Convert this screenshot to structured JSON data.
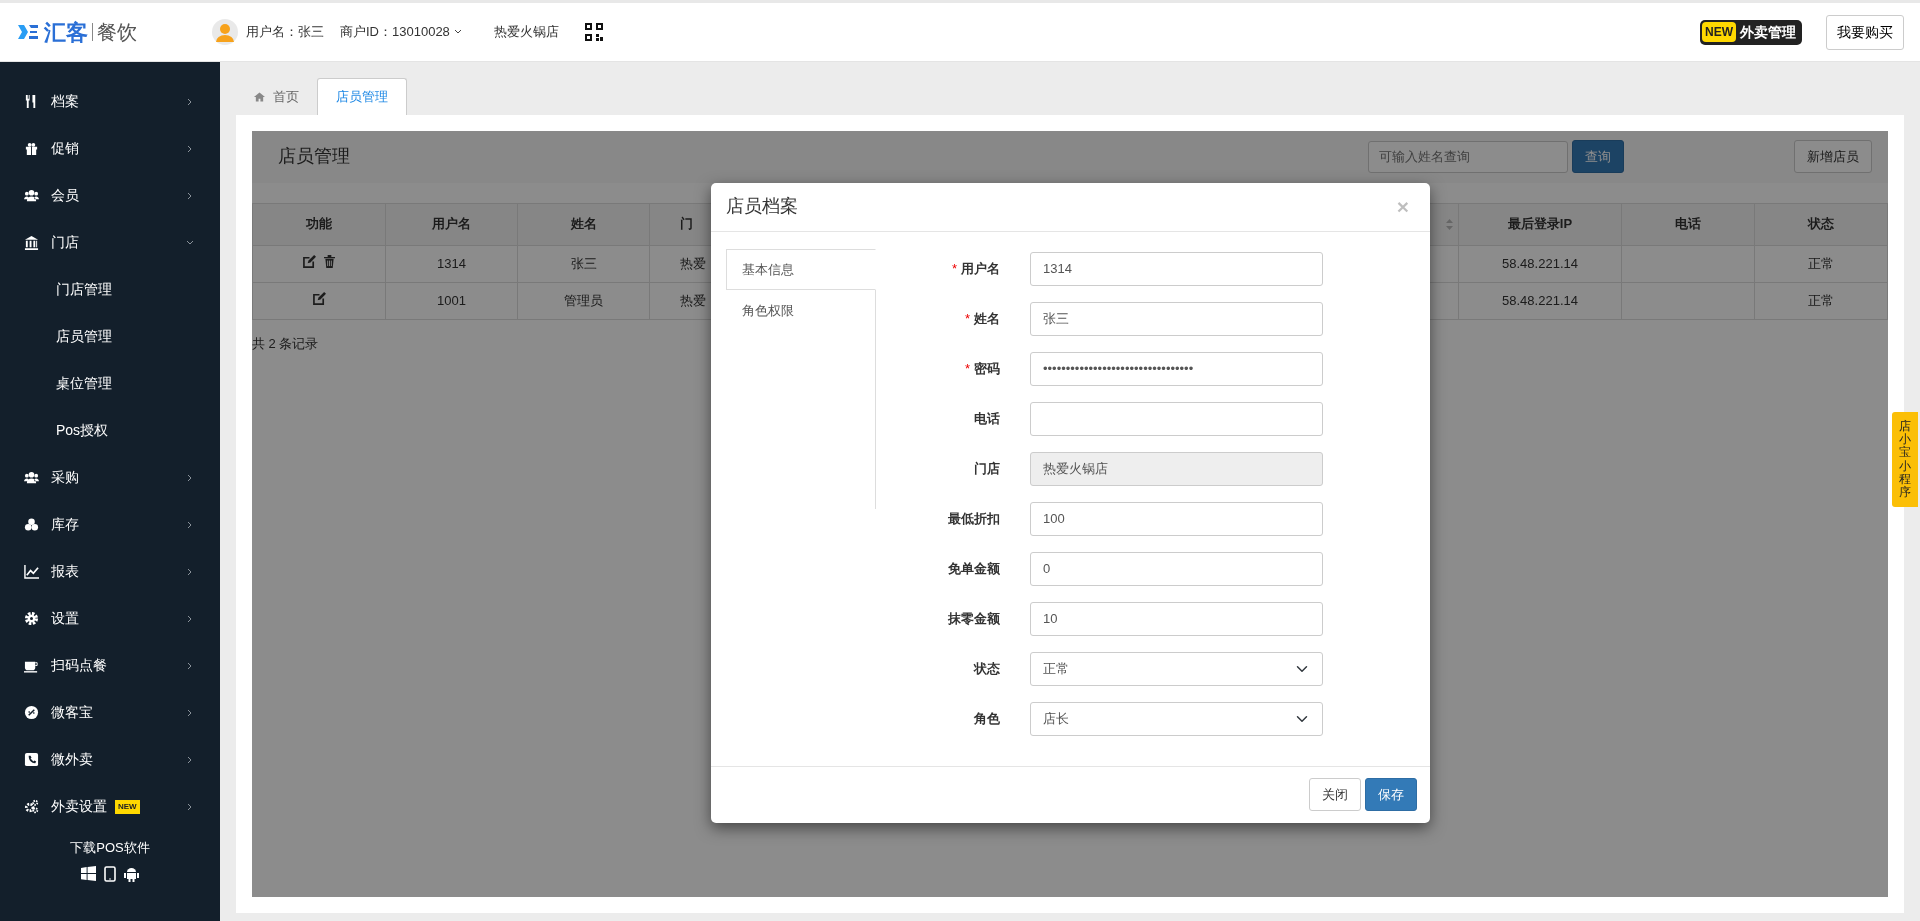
{
  "header": {
    "logo": {
      "brand": "汇客",
      "product": "餐饮"
    },
    "user": "用户名：张三",
    "merchant_id": "商户ID：13010028",
    "store": "热爱火锅店",
    "promo": {
      "badge": "NEW",
      "label": "外卖管理"
    },
    "buy_button": "我要购买"
  },
  "sidebar": {
    "items": [
      {
        "label": "档案",
        "expanded": false
      },
      {
        "label": "促销",
        "expanded": false
      },
      {
        "label": "会员",
        "expanded": false
      },
      {
        "label": "门店",
        "expanded": true,
        "children": [
          {
            "label": "门店管理"
          },
          {
            "label": "店员管理"
          },
          {
            "label": "桌位管理"
          },
          {
            "label": "Pos授权"
          }
        ]
      },
      {
        "label": "采购",
        "expanded": false
      },
      {
        "label": "库存",
        "expanded": false
      },
      {
        "label": "报表",
        "expanded": false
      },
      {
        "label": "设置",
        "expanded": false
      },
      {
        "label": "扫码点餐",
        "expanded": false
      },
      {
        "label": "微客宝",
        "expanded": false
      },
      {
        "label": "微外卖",
        "expanded": false
      },
      {
        "label": "外卖设置",
        "expanded": false,
        "badge": "NEW"
      }
    ],
    "download": "下载POS软件"
  },
  "tabs": [
    {
      "label": "首页",
      "selected": false
    },
    {
      "label": "店员管理",
      "selected": true
    }
  ],
  "page": {
    "title": "店员管理",
    "search": {
      "placeholder": "可输入姓名查询"
    },
    "search_button": "查询",
    "add_button": "新增店员",
    "table": {
      "columns": [
        {
          "label": "功能"
        },
        {
          "label": "用户名"
        },
        {
          "label": "姓名"
        },
        {
          "label": "门"
        },
        {
          "sortable": true
        },
        {
          "label": "最后登录IP"
        },
        {
          "label": "电话"
        },
        {
          "label": "状态"
        }
      ],
      "rows": [
        {
          "deletable": true,
          "cells": [
            {},
            {
              "text": "1314"
            },
            {
              "text": "张三"
            },
            {
              "text": "热爱"
            },
            {},
            {
              "text": "58.48.221.14"
            },
            {},
            {
              "text": "正常"
            }
          ]
        },
        {
          "deletable": false,
          "cells": [
            {},
            {
              "text": "1001"
            },
            {
              "text": "管理员"
            },
            {
              "text": "热爱"
            },
            {},
            {
              "text": "58.48.221.14"
            },
            {},
            {
              "text": "正常"
            }
          ]
        }
      ]
    },
    "footer": "共 2 条记录"
  },
  "modal": {
    "title": "店员档案",
    "close": "×",
    "required_mark": "*",
    "tabs": [
      {
        "label": "基本信息",
        "selected": true
      },
      {
        "label": "角色权限",
        "selected": false
      }
    ],
    "fields": [
      {
        "label": "用户名",
        "required": true,
        "kind": "text",
        "disabled": false,
        "value": "1314"
      },
      {
        "label": "姓名",
        "required": true,
        "kind": "text",
        "disabled": false,
        "value": "张三"
      },
      {
        "label": "密码",
        "required": true,
        "kind": "text",
        "disabled": false,
        "value": "•••••••••••••••••••••••••••••••••"
      },
      {
        "label": "电话",
        "required": false,
        "kind": "text",
        "disabled": false
      },
      {
        "label": "门店",
        "required": false,
        "kind": "text",
        "disabled": true,
        "value": "热爱火锅店"
      },
      {
        "label": "最低折扣",
        "required": false,
        "kind": "text",
        "disabled": false,
        "value": "100"
      },
      {
        "label": "免单金额",
        "required": false,
        "kind": "text",
        "disabled": false,
        "value": "0"
      },
      {
        "label": "抹零金额",
        "required": false,
        "kind": "text",
        "disabled": false,
        "value": "10"
      },
      {
        "label": "状态",
        "required": false,
        "kind": "select",
        "disabled": false,
        "value": "正常"
      },
      {
        "label": "角色",
        "required": false,
        "kind": "select",
        "disabled": false,
        "value": "店长"
      }
    ],
    "buttons": [
      {
        "label": "关闭",
        "kind": "default"
      },
      {
        "label": "保存",
        "kind": "primary"
      }
    ]
  },
  "side_tab": {
    "label": "店小宝小程序"
  }
}
